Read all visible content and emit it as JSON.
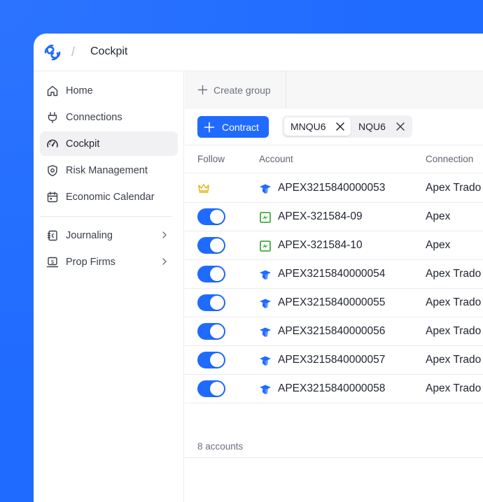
{
  "app": {
    "title": "Cockpit",
    "separator": "/"
  },
  "colors": {
    "accent": "#1f6bff",
    "crown": "#e7b514",
    "apex_blue": "#1f6bff",
    "green_icon": "#3fae3a"
  },
  "sidebar": {
    "items": [
      {
        "label": "Home",
        "icon": "home-icon"
      },
      {
        "label": "Connections",
        "icon": "plug-icon"
      },
      {
        "label": "Cockpit",
        "icon": "gauge-icon",
        "active": true
      },
      {
        "label": "Risk Management",
        "icon": "shield-icon"
      },
      {
        "label": "Economic Calendar",
        "icon": "calendar-icon"
      }
    ],
    "groups": [
      {
        "label": "Journaling",
        "icon": "journal-icon"
      },
      {
        "label": "Prop Firms",
        "icon": "dollar-screen-icon"
      }
    ]
  },
  "toolbar": {
    "create_group_label": "Create group"
  },
  "filters": {
    "contract_button": "Contract",
    "chips": [
      {
        "label": "MNQU6",
        "selected": true
      },
      {
        "label": "NQU6",
        "selected": false
      }
    ]
  },
  "table": {
    "columns": [
      "Follow",
      "Account",
      "Connection"
    ],
    "rows": [
      {
        "follow": "crown",
        "icon": "apex-logo-icon",
        "account": "APEX3215840000053",
        "connection": "Apex Trado"
      },
      {
        "follow": "on",
        "icon": "green-logo-icon",
        "account": "APEX-321584-09",
        "connection": "Apex"
      },
      {
        "follow": "on",
        "icon": "green-logo-icon",
        "account": "APEX-321584-10",
        "connection": "Apex"
      },
      {
        "follow": "on",
        "icon": "apex-logo-icon",
        "account": "APEX3215840000054",
        "connection": "Apex Trado"
      },
      {
        "follow": "on",
        "icon": "apex-logo-icon",
        "account": "APEX3215840000055",
        "connection": "Apex Trado"
      },
      {
        "follow": "on",
        "icon": "apex-logo-icon",
        "account": "APEX3215840000056",
        "connection": "Apex Trado"
      },
      {
        "follow": "on",
        "icon": "apex-logo-icon",
        "account": "APEX3215840000057",
        "connection": "Apex Trado"
      },
      {
        "follow": "on",
        "icon": "apex-logo-icon",
        "account": "APEX3215840000058",
        "connection": "Apex Trado"
      }
    ],
    "footer": "8 accounts"
  }
}
